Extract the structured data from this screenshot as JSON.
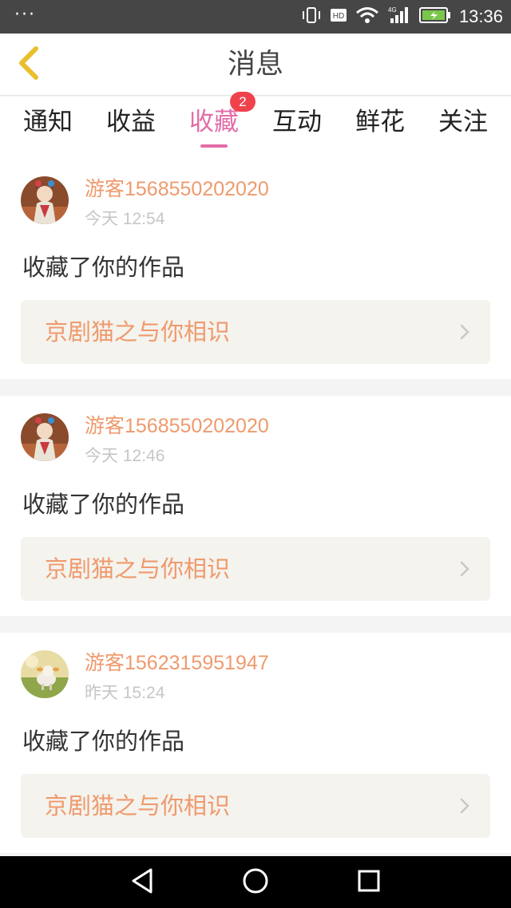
{
  "status_bar": {
    "dots": "···",
    "time": "13:36",
    "hd_label": "HD",
    "network_label": "4G"
  },
  "header": {
    "title": "消息"
  },
  "tabs": [
    {
      "label": "通知"
    },
    {
      "label": "收益"
    },
    {
      "label": "收藏",
      "active": true,
      "badge": "2"
    },
    {
      "label": "互动"
    },
    {
      "label": "鲜花"
    },
    {
      "label": "关注"
    }
  ],
  "messages": [
    {
      "username": "游客1568550202020",
      "time": "今天 12:54",
      "text": "收藏了你的作品",
      "work_title": "京剧猫之与你相识",
      "avatar": "opera-character-avatar"
    },
    {
      "username": "游客1568550202020",
      "time": "今天 12:46",
      "text": "收藏了你的作品",
      "work_title": "京剧猫之与你相识",
      "avatar": "opera-character-avatar"
    },
    {
      "username": "游客1562315951947",
      "time": "昨天 15:24",
      "text": "收藏了你的作品",
      "work_title": "京剧猫之与你相识",
      "avatar": "sheep-landscape-avatar"
    }
  ],
  "colors": {
    "accent_pink": "#e36ca8",
    "username_orange": "#ef9a6d",
    "badge_red": "#f0424c",
    "back_arrow_yellow": "#e8bf2c",
    "link_bg": "#f4f3ee"
  },
  "icons": {
    "back": "chevron-left-icon",
    "chevron": "chevron-right-icon",
    "nav_back": "triangle-back-icon",
    "nav_home": "circle-home-icon",
    "nav_recent": "square-recent-icon"
  }
}
